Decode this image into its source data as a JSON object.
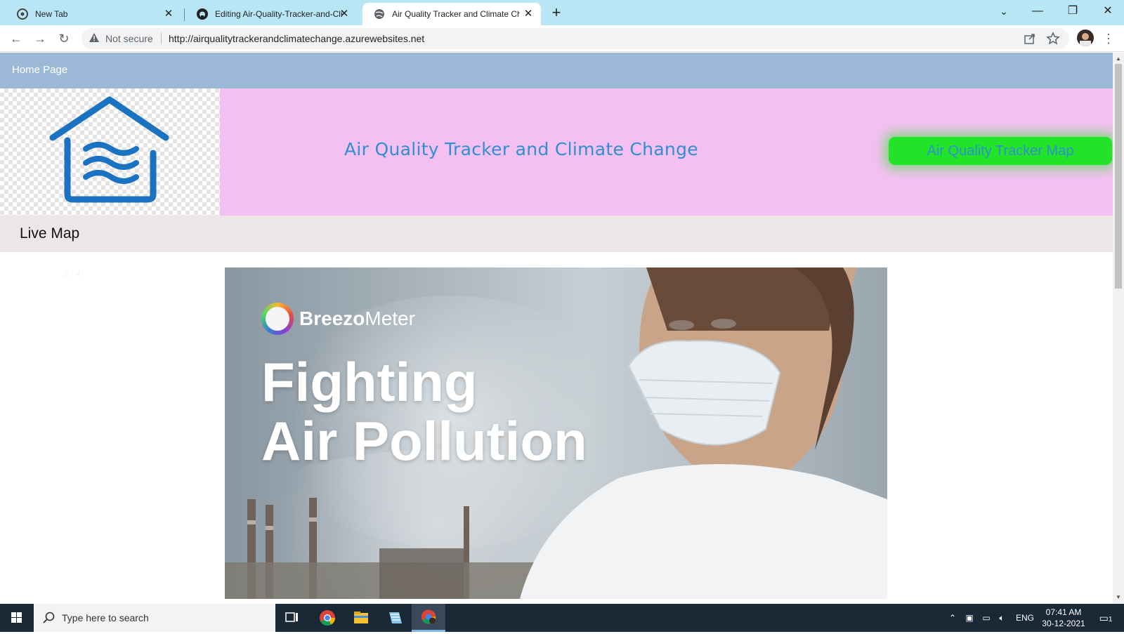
{
  "browser": {
    "tabs": [
      {
        "title": "New Tab",
        "active": false
      },
      {
        "title": "Editing Air-Quality-Tracker-and-Clim",
        "active": false
      },
      {
        "title": "Air Quality Tracker and Climate Char",
        "active": true
      }
    ],
    "new_tab_glyph": "+",
    "window_controls": {
      "minimize": "—",
      "restore": "❐",
      "close": "✕"
    },
    "security_label": "Not secure",
    "url": "http://airqualitytrackerandclimatechange.azurewebsites.net"
  },
  "site": {
    "nav_home": "Home Page",
    "banner_title": "Air Quality Tracker and Climate Change",
    "map_button": "Air Quality Tracker Map",
    "section_title": "Live Map",
    "slide_indicator": "3 / 4",
    "hero": {
      "brand_bold": "Breezo",
      "brand_regular": "Meter",
      "line1": "Fighting",
      "line2": "Air Pollution"
    },
    "colors": {
      "nav_bg": "#9bb8d6",
      "banner_bg": "#f4c0f1",
      "title_color": "#2f8fd2",
      "button_bg": "#22e328",
      "section_bar_bg": "#ece6e6"
    }
  },
  "taskbar": {
    "search_placeholder": "Type here to search",
    "language": "ENG",
    "time": "07:41 AM",
    "date": "30-12-2021",
    "notification_count": "1"
  }
}
